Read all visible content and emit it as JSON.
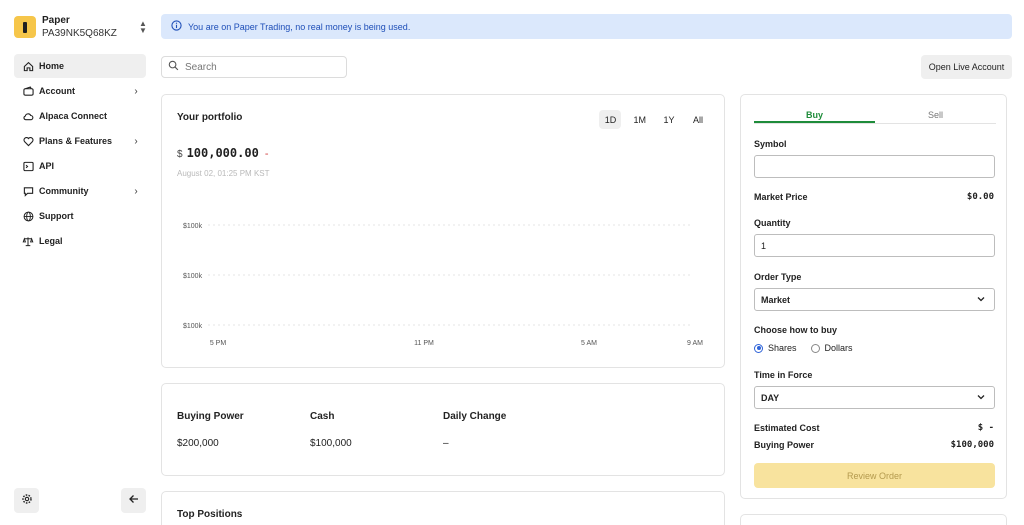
{
  "account": {
    "name": "Paper",
    "id": "PA39NK5Q68KZ"
  },
  "nav": {
    "items": [
      {
        "label": "Home",
        "icon": "home-icon",
        "chevron": false,
        "active": true
      },
      {
        "label": "Account",
        "icon": "wallet-icon",
        "chevron": true,
        "active": false
      },
      {
        "label": "Alpaca Connect",
        "icon": "cloud-icon",
        "chevron": false,
        "active": false
      },
      {
        "label": "Plans & Features",
        "icon": "heart-icon",
        "chevron": true,
        "active": false
      },
      {
        "label": "API",
        "icon": "terminal-icon",
        "chevron": false,
        "active": false
      },
      {
        "label": "Community",
        "icon": "chat-icon",
        "chevron": true,
        "active": false
      },
      {
        "label": "Support",
        "icon": "globe-icon",
        "chevron": false,
        "active": false
      },
      {
        "label": "Legal",
        "icon": "scale-icon",
        "chevron": false,
        "active": false
      }
    ]
  },
  "banner": {
    "text": "You are on Paper Trading, no real money is being used."
  },
  "search": {
    "placeholder": "Search"
  },
  "header": {
    "open_live_label": "Open Live Account"
  },
  "portfolio": {
    "title": "Your portfolio",
    "ranges": [
      "1D",
      "1M",
      "1Y",
      "All"
    ],
    "active_range": "1D",
    "currency": "$",
    "value": "100,000.00",
    "change": "-",
    "date": "August 02, 01:25 PM KST"
  },
  "chart_data": {
    "type": "line",
    "x_ticks": [
      "5 PM",
      "11 PM",
      "5 AM",
      "9 AM"
    ],
    "y_ticks": [
      "$100k",
      "$100k",
      "$100k"
    ],
    "series": [],
    "grid": true
  },
  "balances": [
    {
      "label": "Buying Power",
      "value": "$200,000"
    },
    {
      "label": "Cash",
      "value": "$100,000"
    },
    {
      "label": "Daily Change",
      "value": "–"
    }
  ],
  "positions": {
    "title": "Top Positions"
  },
  "order": {
    "tabs": [
      "Buy",
      "Sell"
    ],
    "active_tab": "Buy",
    "symbol_label": "Symbol",
    "symbol_value": "",
    "market_price_label": "Market Price",
    "market_price_value": "$0.00",
    "quantity_label": "Quantity",
    "quantity_value": "1",
    "order_type_label": "Order Type",
    "order_type_value": "Market",
    "choose_label": "Choose how to buy",
    "shares_label": "Shares",
    "dollars_label": "Dollars",
    "selected_mode": "Shares",
    "tif_label": "Time in Force",
    "tif_value": "DAY",
    "est_cost_label": "Estimated Cost",
    "est_cost_value": "$ -",
    "buying_power_label": "Buying Power",
    "buying_power_value": "$100,000",
    "review_label": "Review Order"
  },
  "colors": {
    "buy_accent": "#1e8c3a",
    "banner_bg": "#dbe8fc",
    "banner_text": "#1f4fb8",
    "review_bg": "#f8e39e",
    "logo": "#f6c64a"
  }
}
